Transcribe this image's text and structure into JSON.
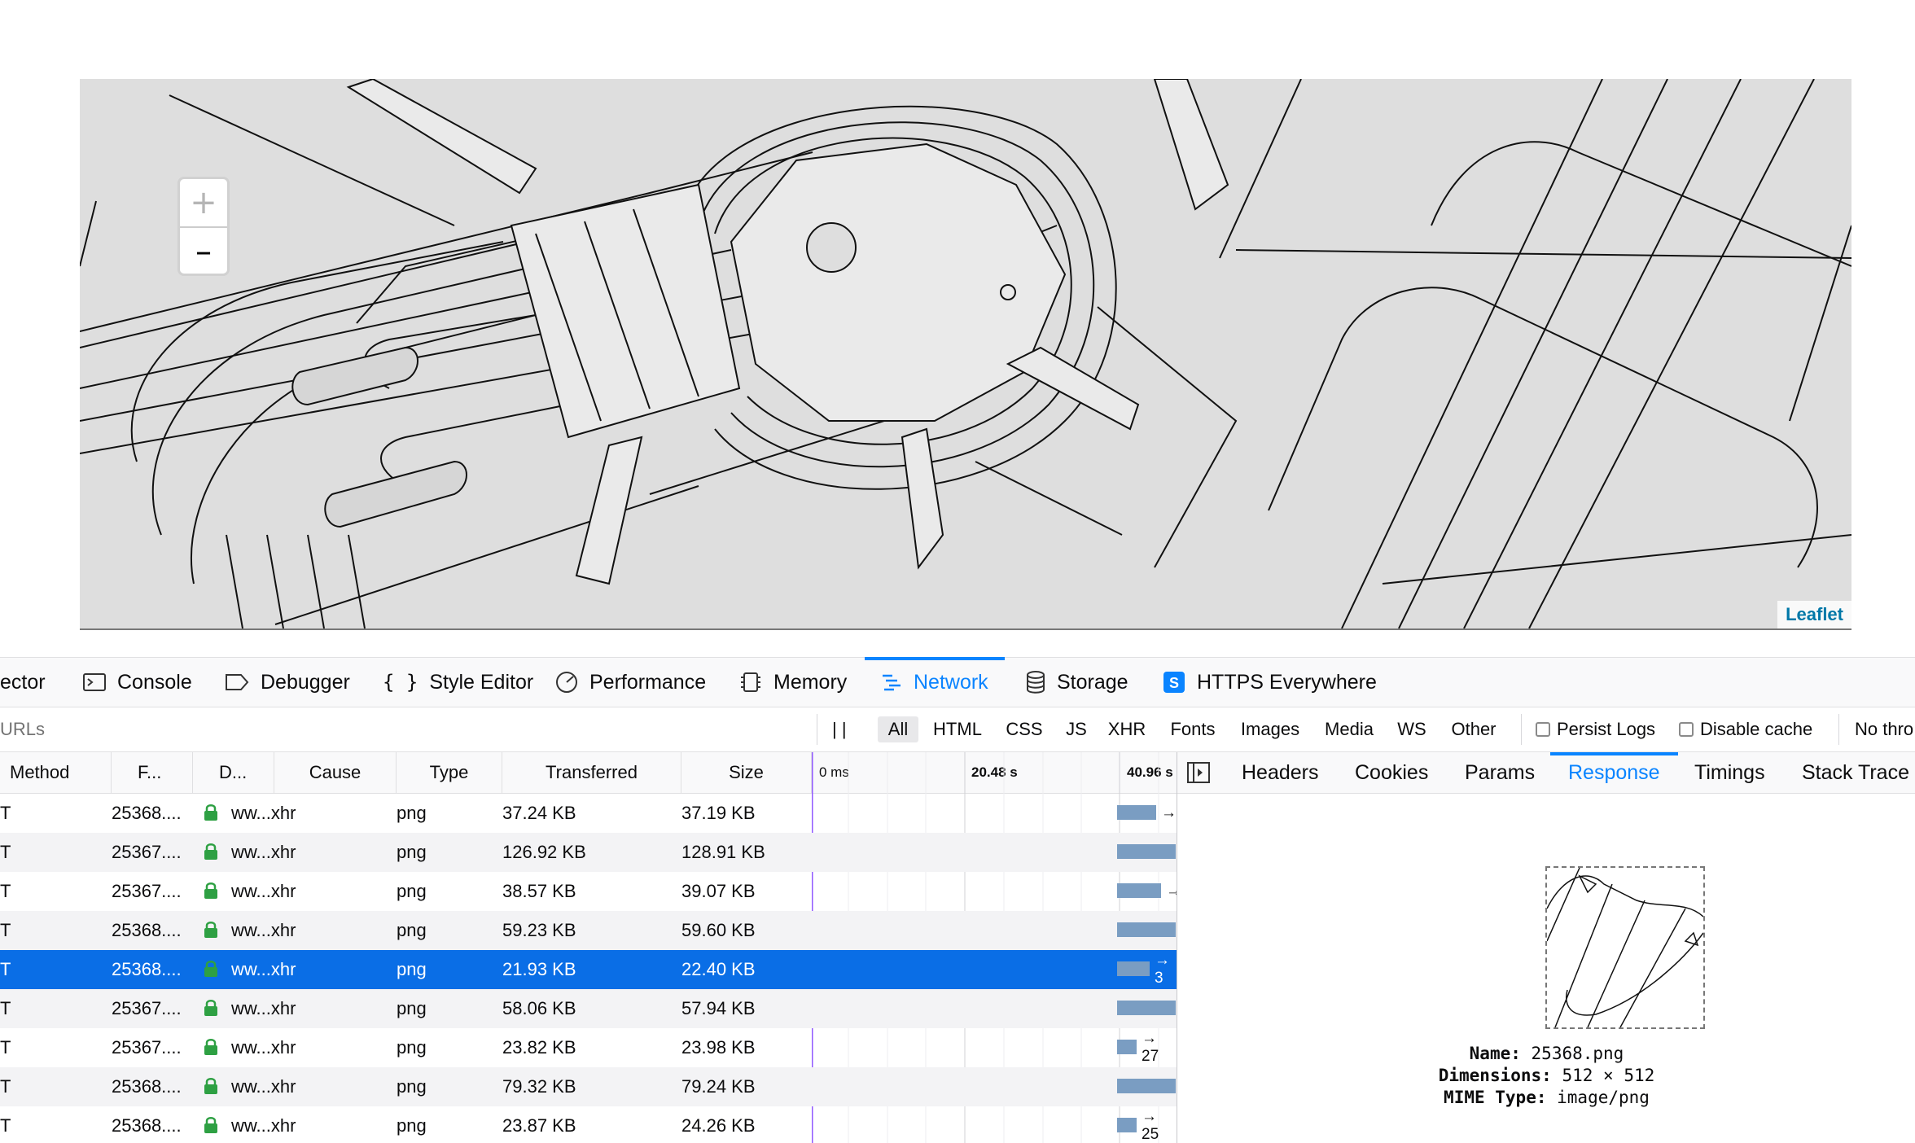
{
  "map": {
    "zoom_in_label": "+",
    "zoom_out_label": "–",
    "attribution": "Leaflet"
  },
  "toolbox": {
    "tabs": [
      {
        "label": "ector",
        "icon": "inspector-icon"
      },
      {
        "label": "Console",
        "icon": "console-icon"
      },
      {
        "label": "Debugger",
        "icon": "debugger-icon"
      },
      {
        "label": "Style Editor",
        "icon": "style-editor-icon"
      },
      {
        "label": "Performance",
        "icon": "performance-icon"
      },
      {
        "label": "Memory",
        "icon": "memory-icon"
      },
      {
        "label": "Network",
        "icon": "network-icon",
        "active": true
      },
      {
        "label": "Storage",
        "icon": "storage-icon"
      },
      {
        "label": "HTTPS Everywhere",
        "icon": "https-everywhere-icon"
      }
    ]
  },
  "filterbar": {
    "url_filter_placeholder": "URLs",
    "pause_label": "| |",
    "types": [
      "All",
      "HTML",
      "CSS",
      "JS",
      "XHR",
      "Fonts",
      "Images",
      "Media",
      "WS",
      "Other"
    ],
    "selected_type": "All",
    "persist_logs": "Persist Logs",
    "disable_cache": "Disable cache",
    "throttling": "No thro"
  },
  "table": {
    "columns": [
      "Method",
      "F...",
      "D...",
      "Cause",
      "Type",
      "Transferred",
      "Size"
    ],
    "timeline_ticks": [
      "0 ms",
      "20.48 s",
      "40.96 s"
    ],
    "rows": [
      {
        "method": "T",
        "file": "25368....",
        "domain": "ww...xhr",
        "type": "png",
        "transferred": "37.24 KB",
        "size": "37.19 KB",
        "arrow": "→",
        "selected": false
      },
      {
        "method": "T",
        "file": "25367....",
        "domain": "ww...xhr",
        "type": "png",
        "transferred": "126.92 KB",
        "size": "128.91 KB",
        "arrow": "",
        "selected": false
      },
      {
        "method": "T",
        "file": "25367....",
        "domain": "ww...xhr",
        "type": "png",
        "transferred": "38.57 KB",
        "size": "39.07 KB",
        "arrow": "→",
        "selected": false
      },
      {
        "method": "T",
        "file": "25368....",
        "domain": "ww...xhr",
        "type": "png",
        "transferred": "59.23 KB",
        "size": "59.60 KB",
        "arrow": "",
        "selected": false
      },
      {
        "method": "T",
        "file": "25368....",
        "domain": "ww...xhr",
        "type": "png",
        "transferred": "21.93 KB",
        "size": "22.40 KB",
        "arrow": "→ 3",
        "selected": true
      },
      {
        "method": "T",
        "file": "25367....",
        "domain": "ww...xhr",
        "type": "png",
        "transferred": "58.06 KB",
        "size": "57.94 KB",
        "arrow": "",
        "selected": false
      },
      {
        "method": "T",
        "file": "25367....",
        "domain": "ww...xhr",
        "type": "png",
        "transferred": "23.82 KB",
        "size": "23.98 KB",
        "arrow": "→ 27",
        "selected": false
      },
      {
        "method": "T",
        "file": "25368....",
        "domain": "ww...xhr",
        "type": "png",
        "transferred": "79.32 KB",
        "size": "79.24 KB",
        "arrow": "",
        "selected": false
      },
      {
        "method": "T",
        "file": "25368....",
        "domain": "ww...xhr",
        "type": "png",
        "transferred": "23.87 KB",
        "size": "24.26 KB",
        "arrow": "→ 25",
        "selected": false
      }
    ]
  },
  "sidepanel": {
    "tabs": [
      "Headers",
      "Cookies",
      "Params",
      "Response",
      "Timings",
      "Stack Trace"
    ],
    "active_tab": "Response",
    "name_label": "Name:",
    "name_value": "25368.png",
    "dimensions_label": "Dimensions:",
    "dimensions_value": "512 × 512",
    "mime_label": "MIME Type:",
    "mime_value": "image/png"
  },
  "colors": {
    "accent": "#0a84ff",
    "selected_row": "#0a6ee6",
    "bar": "#7a9dc2",
    "lock": "#2ea043",
    "map_bg": "#dedede"
  }
}
